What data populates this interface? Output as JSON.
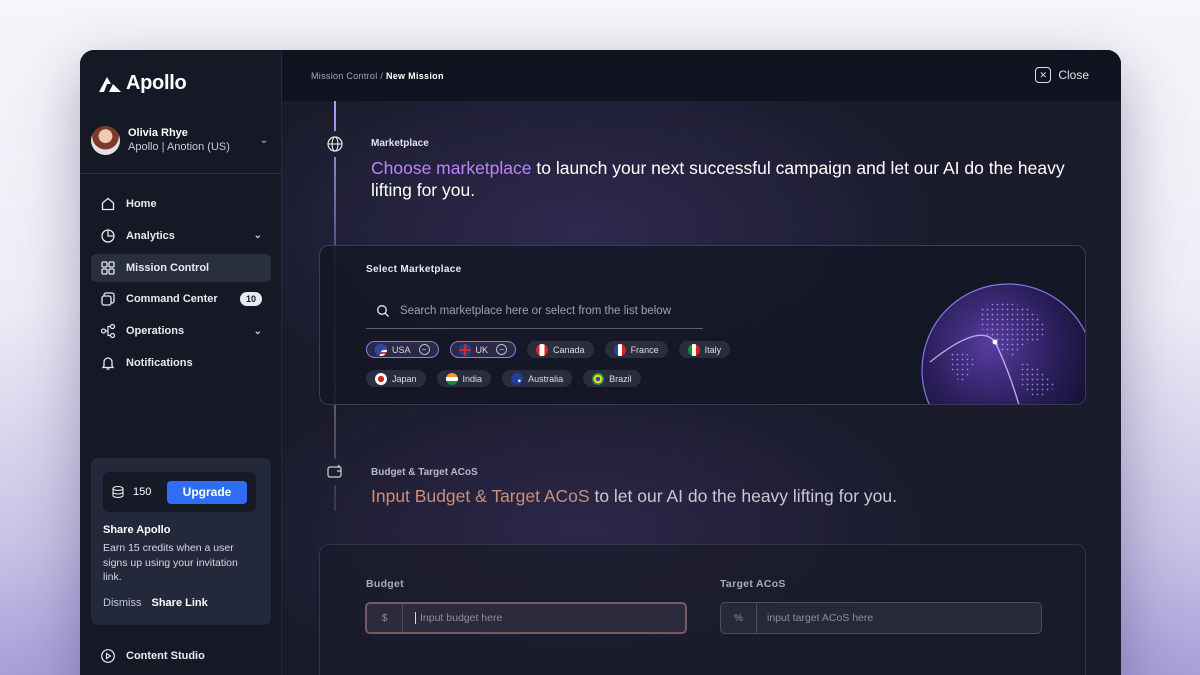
{
  "app": {
    "name": "Apollo"
  },
  "user": {
    "name": "Olivia Rhye",
    "org": "Apollo | Anotion (US)"
  },
  "sidebar": {
    "items": [
      {
        "label": "Home",
        "icon": "home-icon"
      },
      {
        "label": "Analytics",
        "icon": "pie-chart-icon",
        "chevron": true
      },
      {
        "label": "Mission Control",
        "icon": "grid-icon",
        "active": true
      },
      {
        "label": "Command Center",
        "icon": "command-icon",
        "badge": "10"
      },
      {
        "label": "Operations",
        "icon": "flow-icon",
        "chevron": true
      },
      {
        "label": "Notifications",
        "icon": "bell-icon"
      }
    ],
    "bottom_item": {
      "label": "Content Studio",
      "icon": "play-icon"
    }
  },
  "promo": {
    "credits": "150",
    "upgrade_label": "Upgrade",
    "title": "Share Apollo",
    "description": "Earn 15 credits when a user signs up using your invitation link.",
    "dismiss_label": "Dismiss",
    "share_label": "Share Link"
  },
  "header": {
    "breadcrumb_root": "Mission Control",
    "breadcrumb_sep": " / ",
    "breadcrumb_current": "New Mission",
    "close_label": "Close"
  },
  "marketplace_step": {
    "label": "Marketplace",
    "title_accent": "Choose marketplace",
    "title_rest": " to launch your next successful campaign and let our AI do the heavy lifting for you.",
    "card_heading": "Select Marketplace",
    "search_placeholder": "Search marketplace here or select from the list below",
    "countries_row1": [
      {
        "name": "USA",
        "selected": true,
        "flag": "us"
      },
      {
        "name": "UK",
        "selected": true,
        "flag": "uk"
      },
      {
        "name": "Canada",
        "selected": false,
        "flag": "ca"
      },
      {
        "name": "France",
        "selected": false,
        "flag": "fr"
      },
      {
        "name": "Italy",
        "selected": false,
        "flag": "it"
      }
    ],
    "countries_row2": [
      {
        "name": "Japan",
        "selected": false,
        "flag": "jp"
      },
      {
        "name": "India",
        "selected": false,
        "flag": "in"
      },
      {
        "name": "Australia",
        "selected": false,
        "flag": "au"
      },
      {
        "name": "Brazil",
        "selected": false,
        "flag": "br"
      }
    ]
  },
  "budget_step": {
    "label": "Budget & Target ACoS",
    "title_accent": "Input Budget & Target ACoS",
    "title_rest": " to let our AI do the heavy lifting for you.",
    "budget_label": "Budget",
    "budget_prefix": "$",
    "budget_placeholder": "Input budget here",
    "acos_label": "Target ACoS",
    "acos_prefix": "%",
    "acos_placeholder": "input target ACoS here"
  },
  "colors": {
    "accent_purple": "#b987f7",
    "accent_copper": "#c9907a",
    "upgrade_blue": "#2f6df6"
  }
}
